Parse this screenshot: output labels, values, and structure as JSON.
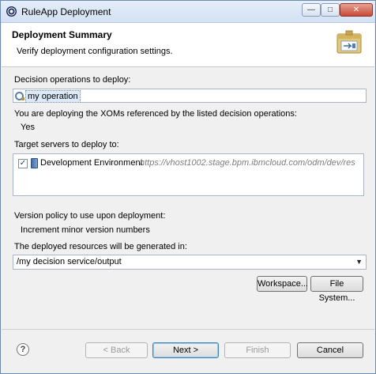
{
  "window": {
    "title": "RuleApp Deployment",
    "controls": {
      "minimize": "—",
      "maximize": "□",
      "close": "✕"
    }
  },
  "banner": {
    "title": "Deployment Summary",
    "description": "Verify deployment configuration settings."
  },
  "operations": {
    "label": "Decision operations to deploy:",
    "items": [
      "my operation"
    ]
  },
  "xoms": {
    "label": "You are deploying the XOMs referenced by the listed decision operations:",
    "value": "Yes"
  },
  "servers": {
    "label": "Target servers to deploy to:",
    "items": [
      {
        "checked": true,
        "check_glyph": "✓",
        "name": "Development Environment",
        "url": "https://vhost1002.stage.bpm.ibmcloud.com/odm/dev/res"
      }
    ]
  },
  "version_policy": {
    "label": "Version policy to use upon deployment:",
    "value": "Increment minor version numbers"
  },
  "output": {
    "label": "The deployed resources will be generated in:",
    "value": "/my decision service/output",
    "arrow": "▼"
  },
  "buttons": {
    "workspace": "Workspace...",
    "file_system": "File System...",
    "back": "< Back",
    "next": "Next >",
    "finish": "Finish",
    "cancel": "Cancel",
    "help": "?"
  },
  "colors": {
    "title_bar": "#d3e1f2",
    "selection": "#dce9f9",
    "url_text": "#7d7d7d"
  }
}
